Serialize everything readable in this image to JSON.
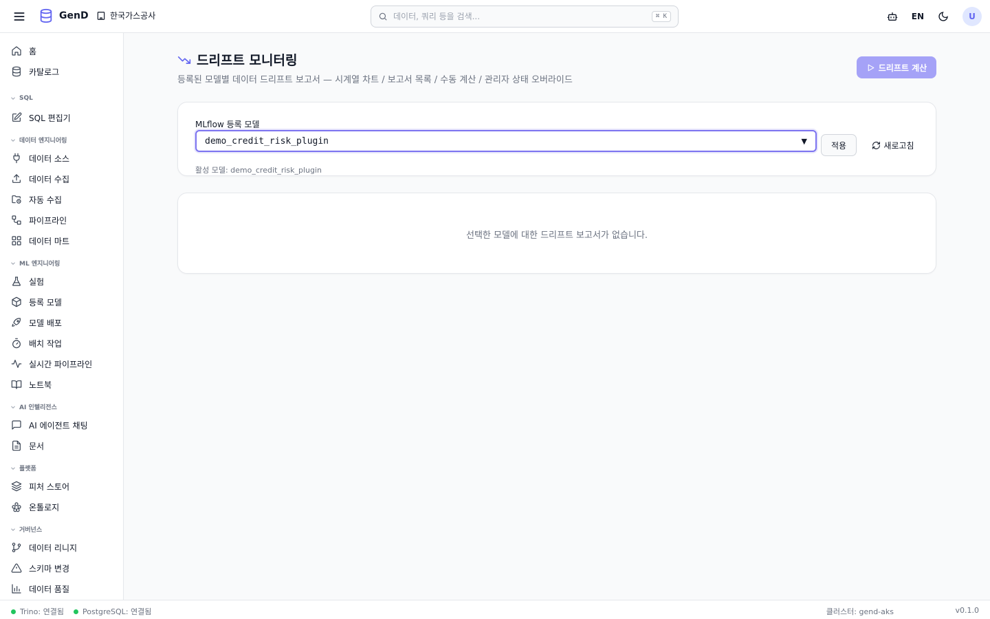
{
  "header": {
    "brand": "GenD",
    "org": "한국가스공사",
    "search": {
      "placeholder": "데이터, 쿼리 등을 검색...",
      "shortcut": "⌘ K"
    },
    "lang": "EN",
    "avatar": "U"
  },
  "sidebar": {
    "items": {
      "home": "홈",
      "catalog": "카탈로그",
      "sql_editor": "SQL 편집기",
      "data_source": "데이터 소스",
      "data_ingest": "데이터 수집",
      "auto_ingest": "자동 수집",
      "pipeline": "파이프라인",
      "data_mart": "데이터 마트",
      "experiment": "실험",
      "registered_model": "등록 모델",
      "model_deploy": "모델 배포",
      "batch_job": "배치 작업",
      "realtime_pipeline": "실시간 파이프라인",
      "notebook": "노트북",
      "ai_agent_chat": "AI 에이전트 채팅",
      "docs": "문서",
      "feature_store": "피처 스토어",
      "ontology": "온톨로지",
      "data_lineage": "데이터 리니지",
      "schema_change": "스키마 변경",
      "data_quality": "데이터 품질"
    },
    "sections": {
      "sql": "SQL",
      "data_eng": "데이터 엔지니어링",
      "ml_eng": "ML 엔지니어링",
      "ai_intel": "AI 인텔리전스",
      "platform": "플랫폼",
      "governance": "거버넌스"
    }
  },
  "main": {
    "title": "드리프트 모니터링",
    "subtitle": "등록된 모델별 데이터 드리프트 보고서 — 시계열 차트 / 보고서 목록 / 수동 계산 / 관리자 상태 오버라이드",
    "compute_button": "드리프트 계산",
    "model_field_label": "MLflow 등록 모델",
    "selected_model": "demo_credit_risk_plugin",
    "apply_button": "적용",
    "refresh_button": "새로고침",
    "active_model": "활성 모델: demo_credit_risk_plugin",
    "empty_message": "선택한 모델에 대한 드리프트 보고서가 없습니다."
  },
  "statusbar": {
    "trino": "Trino: 연결됨",
    "postgres": "PostgreSQL: 연결됨",
    "cluster": "클러스터: gend-aks",
    "version": "v0.1.0"
  },
  "colors": {
    "accent": "#6366f1",
    "accent_button": "#a5a2f7",
    "status_ok": "#22c55e"
  }
}
